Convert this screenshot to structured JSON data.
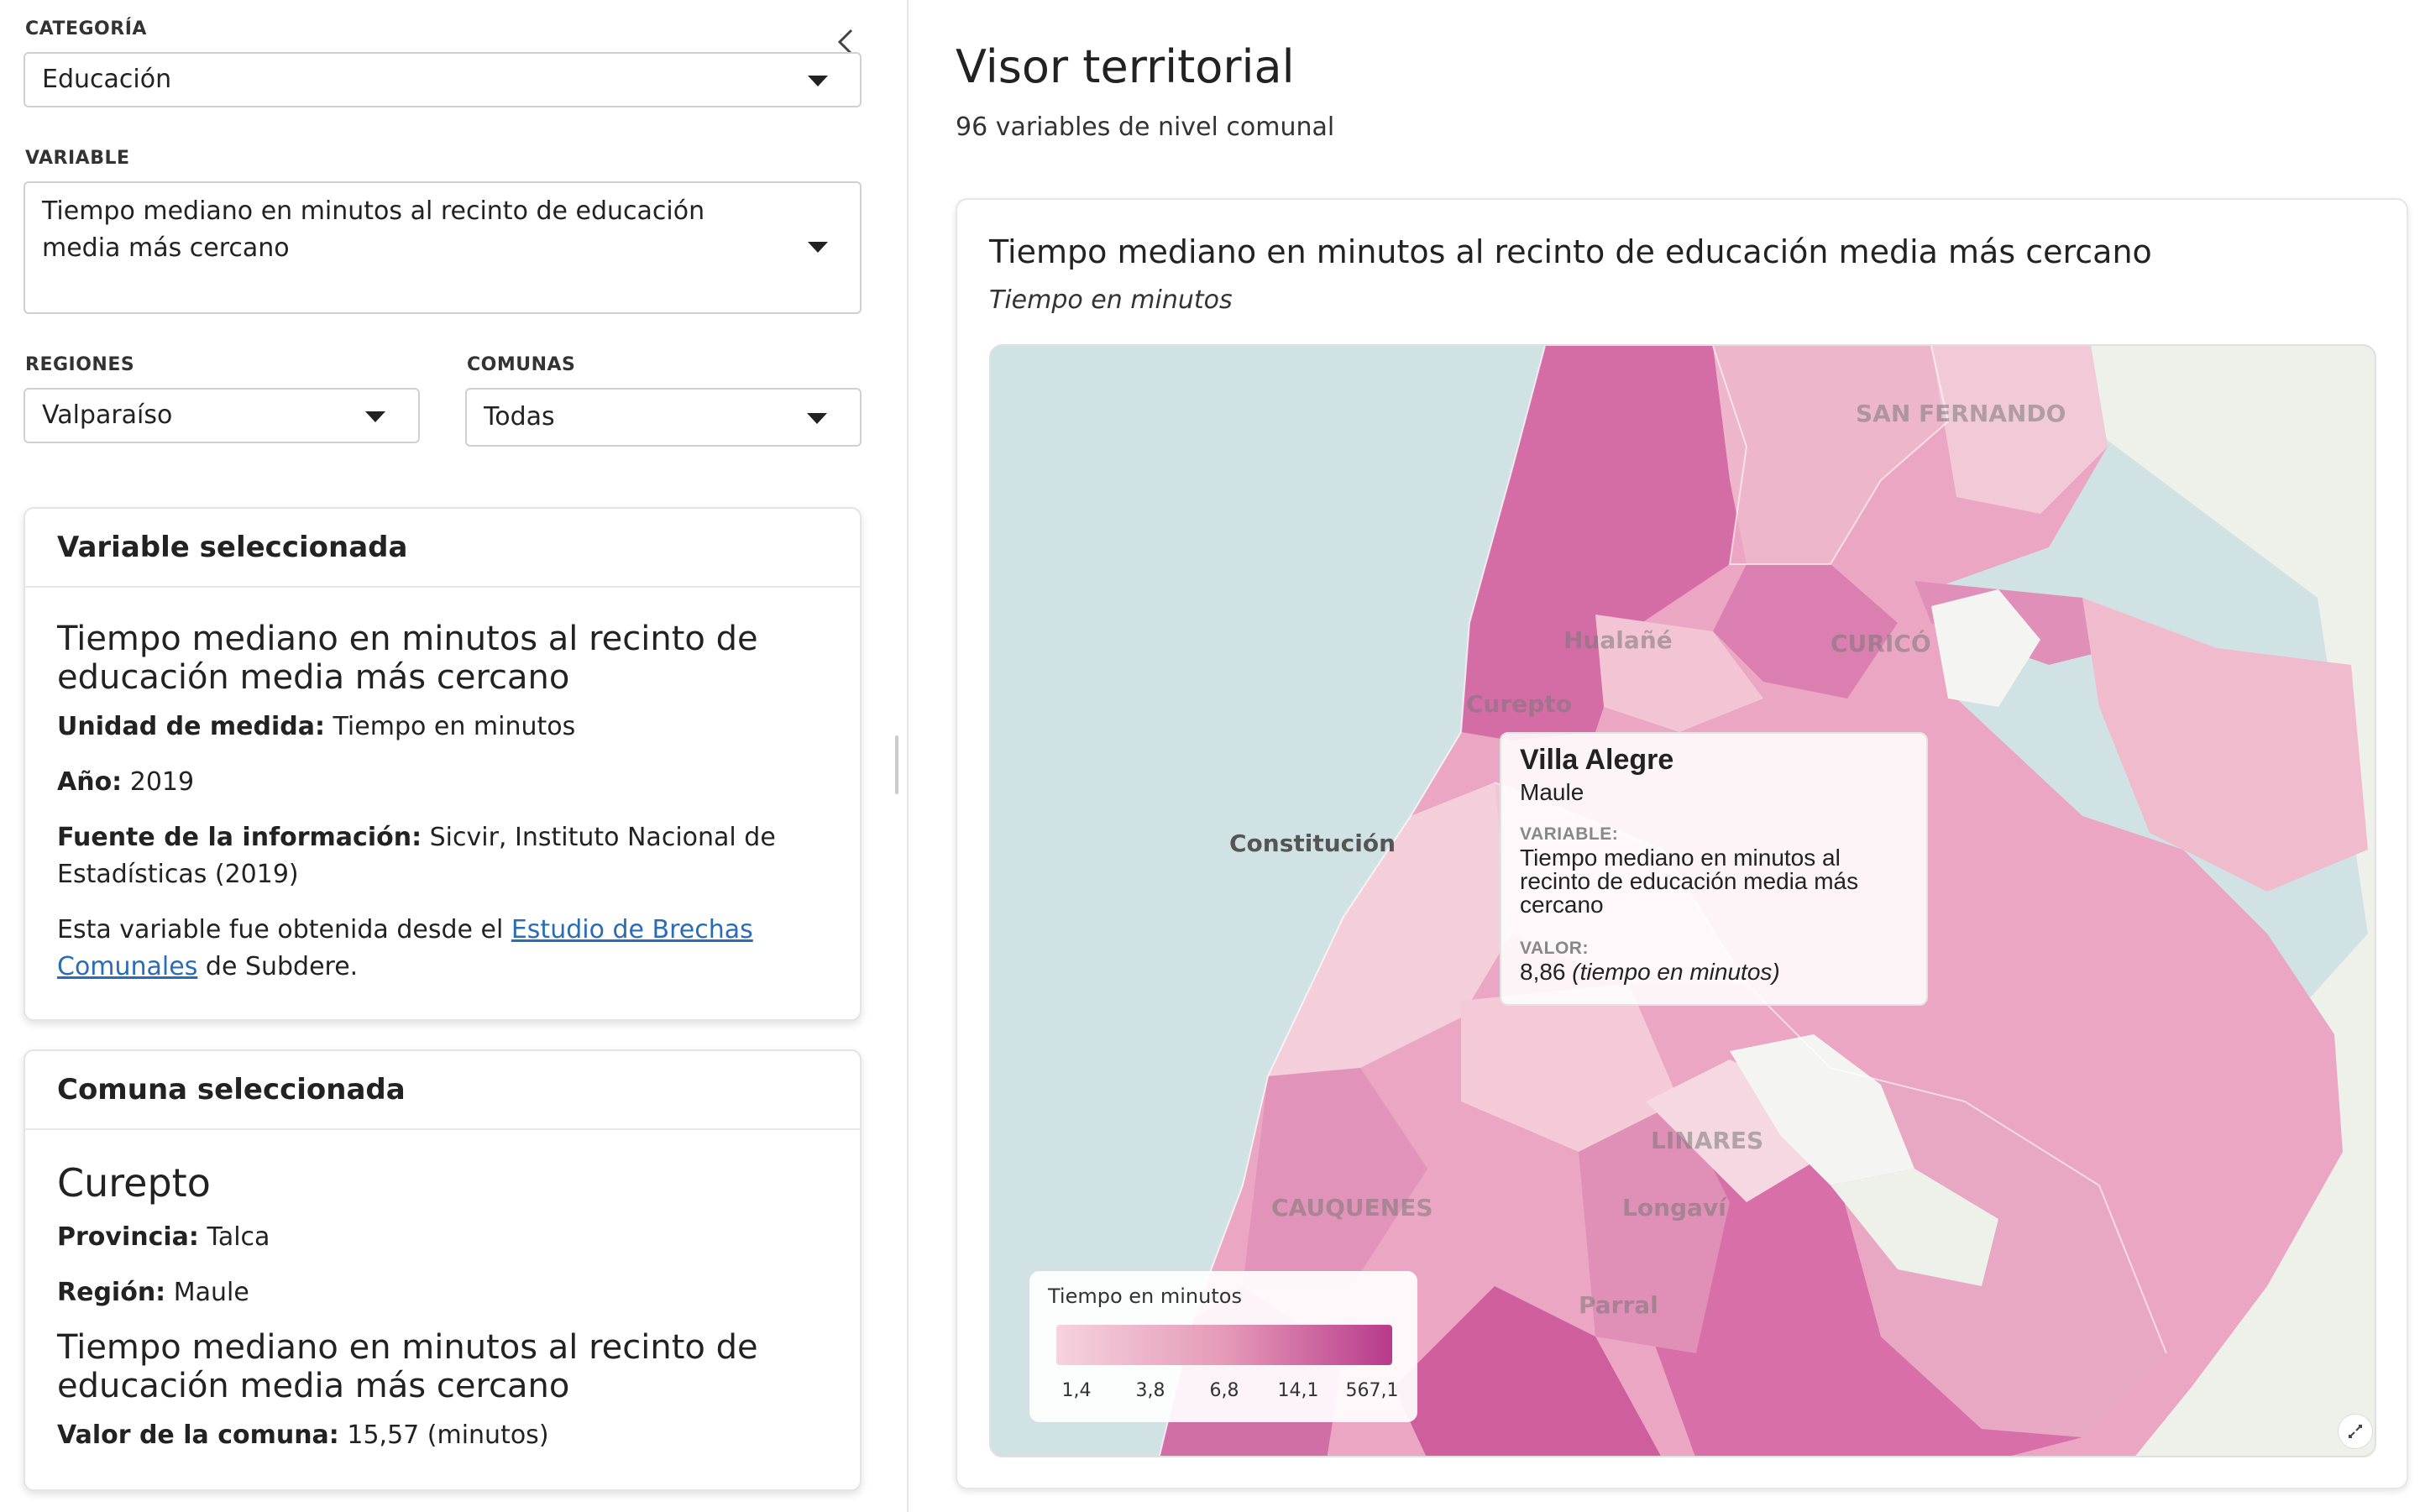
{
  "filters": {
    "categoria": {
      "label": "CATEGORÍA",
      "value": "Educación"
    },
    "variable": {
      "label": "VARIABLE",
      "value": "Tiempo mediano en minutos al recinto de educación media más cercano"
    },
    "regiones": {
      "label": "REGIONES",
      "value": "Valparaíso"
    },
    "comunas": {
      "label": "COMUNAS",
      "value": "Todas"
    }
  },
  "variable_card": {
    "header": "Variable seleccionada",
    "title": "Tiempo mediano en minutos al recinto de educación media más cercano",
    "unidad_label": "Unidad de medida:",
    "unidad_value": "Tiempo en minutos",
    "anio_label": "Año:",
    "anio_value": "2019",
    "fuente_label": "Fuente de la información:",
    "fuente_value": "Sicvir, Instituto Nacional de Estadísticas (2019)",
    "note_prefix": "Esta variable fue obtenida desde el",
    "note_link": "Estudio de Brechas Comunales",
    "note_suffix": "de Subdere."
  },
  "comuna_card": {
    "header": "Comuna seleccionada",
    "name": "Curepto",
    "provincia_label": "Provincia:",
    "provincia_value": "Talca",
    "region_label": "Región:",
    "region_value": "Maule",
    "variable_title": "Tiempo mediano en minutos al recinto de educación media más cercano",
    "valor_label": "Valor de la comuna:",
    "valor_value": "15,57 (minutos)"
  },
  "main": {
    "title": "Visor territorial",
    "subtitle": "96 variables de nivel comunal",
    "map_title": "Tiempo mediano en minutos al recinto de educación media más cercano",
    "map_subtitle": "Tiempo en minutos"
  },
  "map": {
    "labels": {
      "san_fernando": "SAN FERNANDO",
      "curico": "CURICÓ",
      "hualane": "Hualañé",
      "curepto": "Curepto",
      "constitucion": "Constitución",
      "linares": "LINARES",
      "cauquenes": "CAUQUENES",
      "longavi": "Longaví",
      "parral": "Parral"
    },
    "tooltip": {
      "name": "Villa Alegre",
      "region": "Maule",
      "variable_label": "VARIABLE:",
      "variable_text": "Tiempo mediano en minutos al recinto de educación media más cercano",
      "valor_label": "VALOR:",
      "valor_number": "8,86",
      "valor_unit": "(tiempo en minutos)"
    },
    "legend": {
      "title": "Tiempo en minutos",
      "ticks": [
        "1,4",
        "3,8",
        "6,8",
        "14,1",
        "567,1"
      ],
      "color_low": "#f6d3de",
      "color_high": "#b83a8b"
    }
  }
}
